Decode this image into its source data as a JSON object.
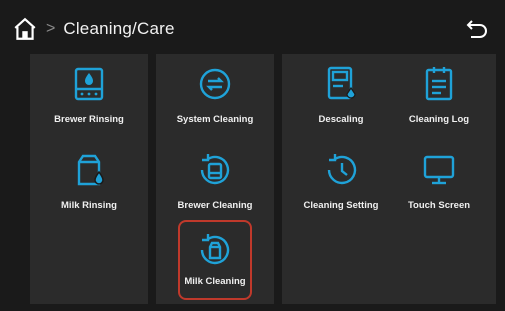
{
  "header": {
    "breadcrumb_sep": ">",
    "title": "Cleaning/Care"
  },
  "accent_color": "#1fa2d8",
  "selection_color": "#c0392b",
  "panels": [
    {
      "tiles": [
        {
          "label": "Brewer Rinsing",
          "icon": "brewer-rinsing-icon"
        },
        {
          "label": "Milk Rinsing",
          "icon": "milk-rinsing-icon"
        }
      ]
    },
    {
      "tiles": [
        {
          "label": "System Cleaning",
          "icon": "system-cleaning-icon"
        },
        {
          "label": "Brewer Cleaning",
          "icon": "brewer-cleaning-icon"
        },
        {
          "label": "Milk Cleaning",
          "icon": "milk-cleaning-icon",
          "selected": true
        }
      ]
    },
    {
      "tiles": [
        {
          "label": "Descaling",
          "icon": "descaling-icon"
        },
        {
          "label": "Cleaning Log",
          "icon": "cleaning-log-icon"
        },
        {
          "label": "Cleaning Setting",
          "icon": "cleaning-setting-icon"
        },
        {
          "label": "Touch Screen",
          "icon": "touch-screen-icon"
        }
      ]
    }
  ]
}
